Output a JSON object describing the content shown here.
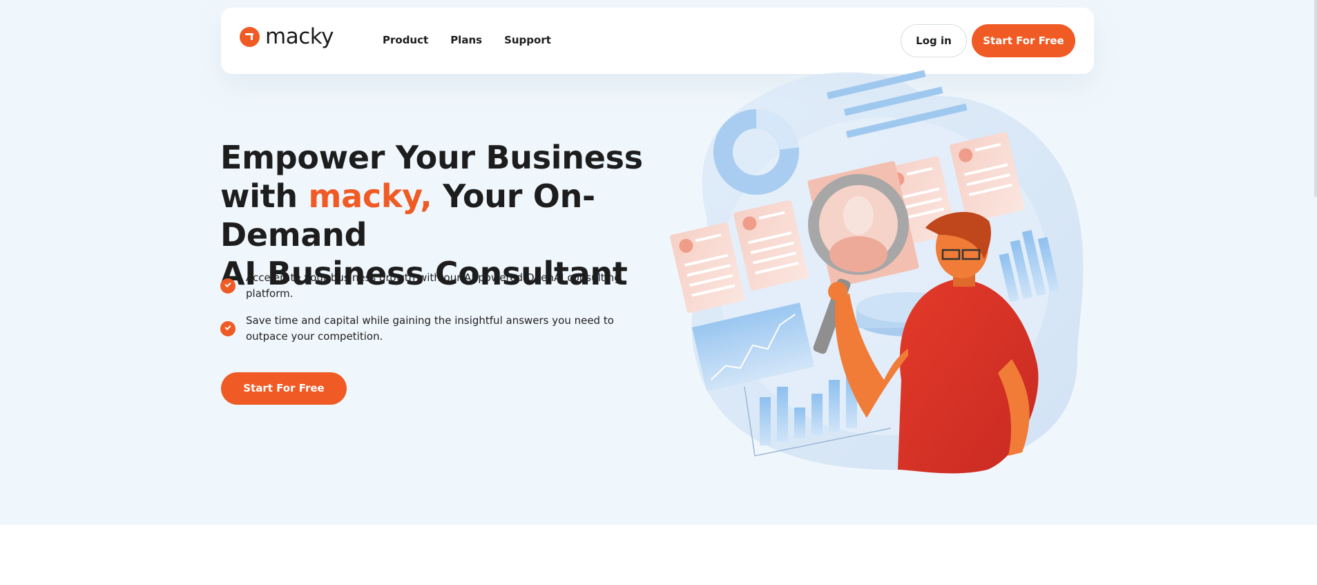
{
  "brand": {
    "name": "macky",
    "accent": "#f05a24"
  },
  "nav": {
    "links": [
      "Product",
      "Plans",
      "Support"
    ],
    "login_label": "Log in",
    "cta_label": "Start For Free"
  },
  "hero": {
    "headline_line1": "Empower Your Business",
    "headline_line2_pre": "with ",
    "headline_line2_accent": "macky,",
    "headline_line2_post": " Your On-Demand",
    "headline_line3": "AI Business Consultant",
    "benefits": [
      "Accelerate your business growth with our AI-powered OpenAI consulting platform.",
      "Save time and capital while gaining the insightful answers you need to outpace your competition."
    ],
    "cta_label": "Start For Free"
  },
  "colors": {
    "hero_background": "#f0f7fc",
    "text": "#1c1c1c"
  },
  "icons": [
    "logo-mark-icon",
    "check-icon"
  ]
}
